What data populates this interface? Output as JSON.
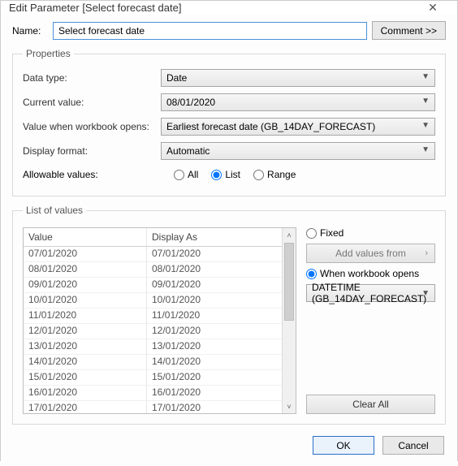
{
  "title": "Edit Parameter [Select forecast date]",
  "close_glyph": "✕",
  "name_label": "Name:",
  "name_value": "Select forecast date",
  "comment_label": "Comment >>",
  "properties": {
    "legend": "Properties",
    "data_type_label": "Data type:",
    "data_type_value": "Date",
    "current_value_label": "Current value:",
    "current_value_value": "08/01/2020",
    "on_open_label": "Value when workbook opens:",
    "on_open_value": "Earliest forecast date (GB_14DAY_FORECAST)",
    "display_format_label": "Display format:",
    "display_format_value": "Automatic",
    "allowable_label": "Allowable values:",
    "allow_all": "All",
    "allow_list": "List",
    "allow_range": "Range"
  },
  "lov": {
    "legend": "List of values",
    "col_value": "Value",
    "col_display": "Display As",
    "rows": [
      {
        "v": "07/01/2020",
        "d": "07/01/2020"
      },
      {
        "v": "08/01/2020",
        "d": "08/01/2020"
      },
      {
        "v": "09/01/2020",
        "d": "09/01/2020"
      },
      {
        "v": "10/01/2020",
        "d": "10/01/2020"
      },
      {
        "v": "11/01/2020",
        "d": "11/01/2020"
      },
      {
        "v": "12/01/2020",
        "d": "12/01/2020"
      },
      {
        "v": "13/01/2020",
        "d": "13/01/2020"
      },
      {
        "v": "14/01/2020",
        "d": "14/01/2020"
      },
      {
        "v": "15/01/2020",
        "d": "15/01/2020"
      },
      {
        "v": "16/01/2020",
        "d": "16/01/2020"
      },
      {
        "v": "17/01/2020",
        "d": "17/01/2020"
      }
    ],
    "fixed_label": "Fixed",
    "add_values_label": "Add values from",
    "when_open_label": "When workbook opens",
    "source_value": "DATETIME (GB_14DAY_FORECAST)",
    "clear_all_label": "Clear All"
  },
  "footer": {
    "ok": "OK",
    "cancel": "Cancel"
  },
  "glyphs": {
    "dd_arrow": "▼",
    "chev_right": "›",
    "scroll_up": "˄",
    "scroll_down": "˅"
  }
}
